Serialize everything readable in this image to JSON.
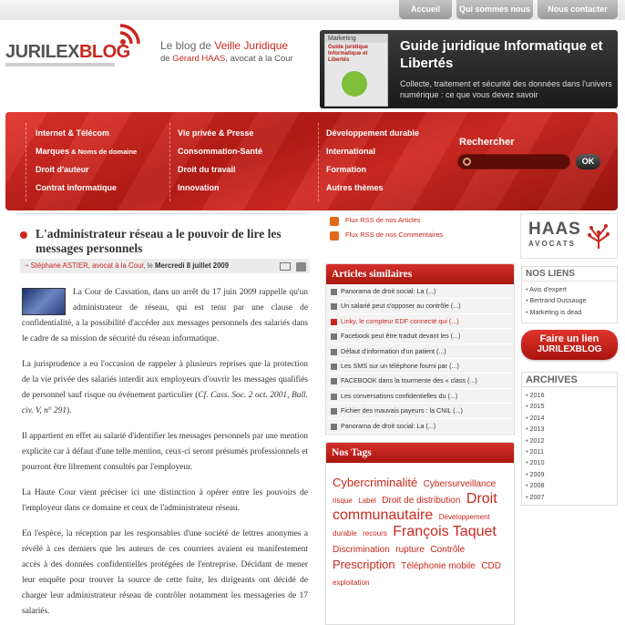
{
  "topnav": {
    "home": "Accueil",
    "about": "Qui sommes nous ?",
    "contact": "Nous contacter"
  },
  "header": {
    "logo_a": "JURILEX",
    "logo_b": "BLOG",
    "tagline_prefix": "Le blog de ",
    "tagline_topic": "Veille Juridique",
    "author_prefix": "de ",
    "author_name": "Gérard HAAS",
    "author_suffix": ", avocat à la Cour"
  },
  "promo": {
    "book_top": "Marketing",
    "book_title": "Guide juridique Informatique et Libertés",
    "title": "Guide juridique Informatique et Libertés",
    "subtitle": "Collecte, traitement et sécurité des données dans l'univers numérique : ce que vous devez savoir"
  },
  "menu": {
    "col1": [
      "Internet & Télécom",
      "Marques",
      "Droit d'auteur",
      "Contrat informatique"
    ],
    "col1_marques_suffix": " & Noms de domaine",
    "col2": [
      "Vie privée & Presse",
      "Consommation-Santé",
      "Droit du travail",
      "Innovation"
    ],
    "col3": [
      "Développement durable",
      "International",
      "Formation",
      "Autres thèmes"
    ],
    "search_label": "Rechercher",
    "search_value": "",
    "search_button": "OK"
  },
  "article": {
    "title": "L'administrateur réseau a le pouvoir de lire les messages personnels",
    "author": "Stéphane ASTIER, avocat à la Cour",
    "date_prefix": ", le ",
    "date": "Mercredi 8 juillet 2009",
    "p1": "La Cour de Cassation, dans un arrêt du 17 juin 2009 rappelle qu'un administrateur de réseau, qui est tenu par une clause de confidentialité, a la possibilité d'accéder aux messages personnels des salariés dans le cadre de sa mission de sécurité du réseau informatique.",
    "p2a": "La jurisprudence a eu l'occasion de rappeler à plusieurs reprises que la protection de la vie privée des salariés interdit aux employeurs d'ouvrir les messages qualifiés de personnel sauf risque ou événement particulier (",
    "p2_cite": "Cf. Cass. Soc. 2 oct. 2001, Bull. civ. V, n° 291",
    "p2b": ").",
    "p3": "Il appartient en effet au salarié d'identifier les messages personnels par une mention explicite car à défaut d'une telle mention, ceux-ci seront présumés professionnels et pourront être librement consultés par l'employeur.",
    "p4": "La Haute Cour vient préciser ici une distinction à opérer entre les pouvoirs de l'employeur dans ce domaine et ceux de l'administrateur réseau.",
    "p5": "En l'espèce, la réception par les responsables d'une société de lettres anonymes a révélé à ces derniers que les auteurs de ces courriers avaient eu manifestement accès à des données confidentielles protégées de l'entreprise. Décidant de mener leur enquête pour trouver la source de cette fuite, les dirigeants ont décidé de charger leur administrateur réseau de contrôler notamment les messageries de 17 salariés."
  },
  "rss": {
    "articles": "Flux RSS de nos Articles",
    "comments": "Flux RSS de nos Commentaires"
  },
  "similar": {
    "title": "Articles similaires",
    "items": [
      "Panorama de droit social: La (...)",
      "Un salarié peut s'opposer au contrôle (...)",
      "Linky, le compteur EDF connecté qui (...)",
      "Facebook peut être traduit devant les (...)",
      "Défaut d'information d'un patient (...)",
      "Les SMS sur un téléphone fourni par (...)",
      "FACEBOOK dans la tourmente des « class (...)",
      "Les conversations confidentielles du (...)",
      "Fichier des mauvais payeurs : la CNIL (...)",
      "Panorama de droit social: La (...)"
    ]
  },
  "tags": {
    "title": "Nos Tags",
    "t1": "Cybercriminalité",
    "t2": "Cybersurveillance",
    "t3": "risque",
    "t4": "Label",
    "t5": "Droit de distribution",
    "t6": "Droit communautaire",
    "t7": "Développement durable",
    "t8": "recours",
    "t9": "François Taquet",
    "t10": "Discrimination",
    "t11": "rupture",
    "t12": "Contrôle",
    "t13": "Prescription",
    "t14": "Téléphonie mobile",
    "t15": "CDD",
    "t16": "exploitation"
  },
  "haas": {
    "name": "HAAS",
    "sub": "AVOCATS"
  },
  "links": {
    "title": "NOS LIENS",
    "items": [
      "Avis d'expert",
      "Bertrand Dussauge",
      "Marketing is dead"
    ]
  },
  "cta": {
    "line1": "Faire un lien",
    "line2": "JURILEXBLOG"
  },
  "archives": {
    "title": "ARCHIVES",
    "items": [
      "2016",
      "2015",
      "2014",
      "2013",
      "2012",
      "2011",
      "2010",
      "2009",
      "2008",
      "2007"
    ]
  },
  "colors": {
    "brand_red": "#c8281e",
    "banner_dark": "#a8170f",
    "text": "#333333"
  }
}
